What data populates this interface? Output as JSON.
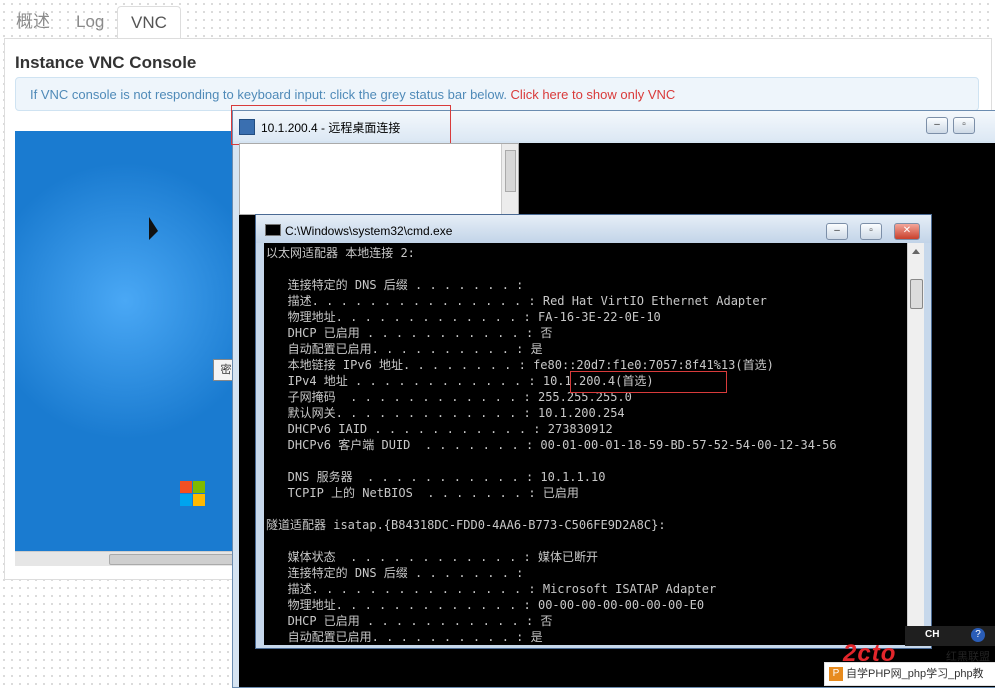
{
  "tabs": [
    {
      "label": "概述"
    },
    {
      "label": "Log"
    },
    {
      "label": "VNC"
    }
  ],
  "page": {
    "title": "Instance VNC Console",
    "alert_text": "If VNC console is not responding to keyboard input: click the grey status bar below. ",
    "alert_link": "Click here to show only VNC"
  },
  "vnc": {
    "input_fragment": "密"
  },
  "rdp": {
    "title": "10.1.200.4 - 远程桌面连接"
  },
  "cmd": {
    "title": "C:\\Windows\\system32\\cmd.exe",
    "lines": [
      "以太网适配器 本地连接 2:",
      "",
      "   连接特定的 DNS 后缀 . . . . . . . :",
      "   描述. . . . . . . . . . . . . . . : Red Hat VirtIO Ethernet Adapter",
      "   物理地址. . . . . . . . . . . . . : FA-16-3E-22-0E-10",
      "   DHCP 已启用 . . . . . . . . . . . : 否",
      "   自动配置已启用. . . . . . . . . . : 是",
      "   本地链接 IPv6 地址. . . . . . . . : fe80::20d7:f1e0:7057:8f41%13(首选)",
      "   IPv4 地址 . . . . . . . . . . . . : 10.1.200.4(首选)",
      "   子网掩码  . . . . . . . . . . . . : 255.255.255.0",
      "   默认网关. . . . . . . . . . . . . : 10.1.200.254",
      "   DHCPv6 IAID . . . . . . . . . . . : 273830912",
      "   DHCPv6 客户端 DUID  . . . . . . . : 00-01-00-01-18-59-BD-57-52-54-00-12-34-56",
      "",
      "   DNS 服务器  . . . . . . . . . . . : 10.1.1.10",
      "   TCPIP 上的 NetBIOS  . . . . . . . : 已启用",
      "",
      "隧道适配器 isatap.{B84318DC-FDD0-4AA6-B773-C506FE9D2A8C}:",
      "",
      "   媒体状态  . . . . . . . . . . . . : 媒体已断开",
      "   连接特定的 DNS 后缀 . . . . . . . :",
      "   描述. . . . . . . . . . . . . . . : Microsoft ISATAP Adapter",
      "   物理地址. . . . . . . . . . . . . : 00-00-00-00-00-00-00-E0",
      "   DHCP 已启用 . . . . . . . . . . . : 否",
      "   自动配置已启用. . . . . . . . . . : 是"
    ]
  },
  "tray": {
    "lang": "CH",
    "help": "?"
  },
  "watermark": {
    "brand": "2cto",
    "sub": "红黑联盟",
    "bar": "自学PHP网_php学习_php教"
  },
  "colors": {
    "accent_link": "#d93a3a",
    "alert_bg": "#eef5fb",
    "highlight_box": "#d83b3b"
  }
}
